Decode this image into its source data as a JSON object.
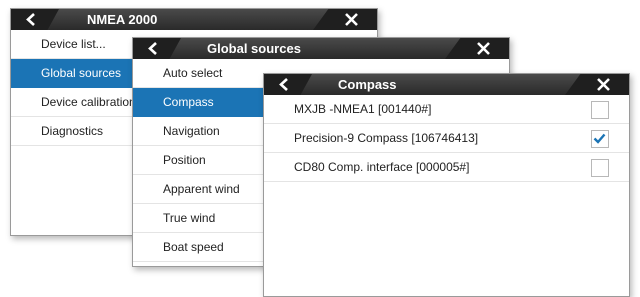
{
  "nmea_panel": {
    "title": "NMEA 2000",
    "items": [
      {
        "label": "Device list..."
      },
      {
        "label": "Global sources"
      },
      {
        "label": "Device calibration"
      },
      {
        "label": "Diagnostics"
      }
    ]
  },
  "global_panel": {
    "title": "Global sources",
    "items": [
      {
        "label": "Auto select"
      },
      {
        "label": "Compass"
      },
      {
        "label": "Navigation"
      },
      {
        "label": "Position"
      },
      {
        "label": "Apparent wind"
      },
      {
        "label": "True wind"
      },
      {
        "label": "Boat speed"
      }
    ]
  },
  "compass_panel": {
    "title": "Compass",
    "sources": [
      {
        "label": "MXJB -NMEA1 [001440#]",
        "checked": false
      },
      {
        "label": "Precision-9 Compass [106746413]",
        "checked": true
      },
      {
        "label": "CD80 Comp. interface [000005#]",
        "checked": false
      }
    ]
  },
  "colors": {
    "selected_bg": "#1b74b5",
    "titlebar_bg": "#2a2a2a",
    "checkmark": "#1b74b5"
  }
}
